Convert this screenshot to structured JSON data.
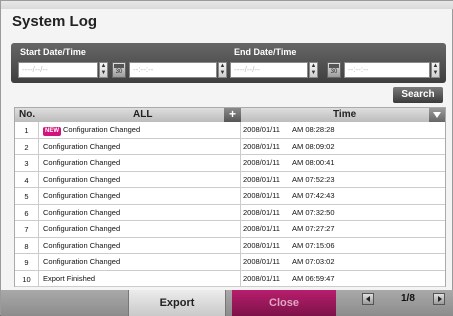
{
  "title": "System Log",
  "start": {
    "label": "Start Date/Time",
    "date_placeholder": "----/--/--",
    "time_placeholder": "--:--:--",
    "calendar_num": "30"
  },
  "end": {
    "label": "End Date/Time",
    "date_placeholder": "----/--/--",
    "time_placeholder": "--:--:--",
    "calendar_num": "30"
  },
  "search_label": "Search",
  "table": {
    "headers": {
      "no": "No.",
      "event": "ALL",
      "add": "+",
      "time": "Time"
    },
    "new_badge": "NEW",
    "rows": [
      {
        "no": "1",
        "event": "Configuration Changed",
        "date": "2008/01/11",
        "time": "AM 08:28:28",
        "is_new": true
      },
      {
        "no": "2",
        "event": "Configuration Changed",
        "date": "2008/01/11",
        "time": "AM 08:09:02",
        "is_new": false
      },
      {
        "no": "3",
        "event": "Configuration Changed",
        "date": "2008/01/11",
        "time": "AM 08:00:41",
        "is_new": false
      },
      {
        "no": "4",
        "event": "Configuration Changed",
        "date": "2008/01/11",
        "time": "AM 07:52:23",
        "is_new": false
      },
      {
        "no": "5",
        "event": "Configuration Changed",
        "date": "2008/01/11",
        "time": "AM 07:42:43",
        "is_new": false
      },
      {
        "no": "6",
        "event": "Configuration Changed",
        "date": "2008/01/11",
        "time": "AM 07:32:50",
        "is_new": false
      },
      {
        "no": "7",
        "event": "Configuration Changed",
        "date": "2008/01/11",
        "time": "AM 07:27:27",
        "is_new": false
      },
      {
        "no": "8",
        "event": "Configuration Changed",
        "date": "2008/01/11",
        "time": "AM 07:15:06",
        "is_new": false
      },
      {
        "no": "9",
        "event": "Configuration Changed",
        "date": "2008/01/11",
        "time": "AM 07:03:02",
        "is_new": false
      },
      {
        "no": "10",
        "event": "Export Finished",
        "date": "2008/01/11",
        "time": "AM 06:59:47",
        "is_new": false
      }
    ]
  },
  "footer": {
    "export_label": "Export",
    "close_label": "Close",
    "page": "1/8"
  }
}
